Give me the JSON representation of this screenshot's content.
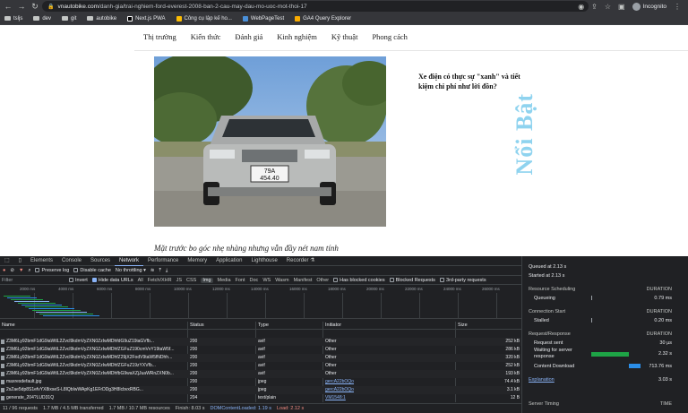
{
  "browser": {
    "url_host": "vnautobike.com",
    "url_path": "/danh-gia/trai-nghiem-ford-everest-2008-ban-2-cau-may-dau-mo-uoc-mot-thoi-17",
    "profile_label": "Incognito",
    "bookmarks": [
      "tsljs",
      "dev",
      "git",
      "autobike",
      "Next.js PWA",
      "Công cụ lập kế ho...",
      "WebPageTest",
      "GA4 Query Explorer"
    ]
  },
  "site": {
    "nav": [
      "Thị trường",
      "Kiến thức",
      "Đánh giá",
      "Kinh nghiệm",
      "Kỹ thuật",
      "Phong cách"
    ],
    "sidebar_headline": "Xe điện có thực sự \"xanh\" và tiết kiệm chi phí như lời đồn?",
    "vertical_label": "Nổi Bật",
    "photo_plate": "79A\n454.40",
    "caption": "Mặt trước bo góc nhẹ nhàng nhưng vẫn đầy nét nam tính"
  },
  "devtools": {
    "tabs": [
      "Elements",
      "Console",
      "Sources",
      "Network",
      "Performance",
      "Memory",
      "Application",
      "Lighthouse",
      "Recorder ⚗"
    ],
    "active_tab": "Network",
    "toolbar": {
      "preserve_log": "Preserve log",
      "disable_cache": "Disable cache",
      "throttling": "No throttling"
    },
    "filter": {
      "placeholder": "Filter",
      "invert": "Invert",
      "hide_data_urls": "Hide data URLs",
      "types": [
        "All",
        "Fetch/XHR",
        "JS",
        "CSS",
        "Img",
        "Media",
        "Font",
        "Doc",
        "WS",
        "Wasm",
        "Manifest",
        "Other"
      ],
      "selected_type": "Img",
      "has_blocked_cookies": "Has blocked cookies",
      "blocked_requests": "Blocked Requests",
      "third_party": "3rd-party requests"
    },
    "timeline_ticks": [
      "2000 ms",
      "4000 ms",
      "6000 ms",
      "8000 ms",
      "10000 ms",
      "12000 ms",
      "14000 ms",
      "16000 ms",
      "18000 ms",
      "20000 ms",
      "22000 ms",
      "24000 ms",
      "26000 ms"
    ],
    "columns": [
      "Name",
      "Status",
      "Type",
      "Initiator",
      "Size"
    ],
    "rows": [
      {
        "name": "Z3M6Ly92bmF1dG9iaWtlL2Zvcl9kdmVyZXN0ZzIwMDhfdG9uZ19iaGVfb...",
        "status": "200",
        "type": "avif",
        "initiator": "Other",
        "size": "252 kB"
      },
      {
        "name": "Z3M6Ly92bmF1dG9iaWtlL2Zvcl9kdmVyZXN0ZzIwMDhfZGFuZ190cmVvY19taW5f...",
        "status": "200",
        "type": "avif",
        "initiator": "Other",
        "size": "286 kB"
      },
      {
        "name": "Z3M6Ly92bmF1dG9iaWtlL2Zvcl9kdmVyZXN0ZzIwMDhfZ29jX2FodV9taW5fNDhh...",
        "status": "200",
        "type": "avif",
        "initiator": "Other",
        "size": "320 kB"
      },
      {
        "name": "Z3M6Ly92bmF1dG9iaWtlL2Zvcl9kdmVyZXN0ZzIwMDhfZGFuZ19zYXVfb...",
        "status": "200",
        "type": "avif",
        "initiator": "Other",
        "size": "252 kB"
      },
      {
        "name": "Z3M6Ly92bmF1dG9iaWtlL2Zvcl9kdmVyZXN0ZzIwMDhfbG9waXZjJuaWRnZXN0b...",
        "status": "200",
        "type": "avif",
        "initiator": "Other",
        "size": "193 kB"
      },
      {
        "name": "maxresdefault.jpg",
        "status": "200",
        "type": "jpeg",
        "initiator": "gercA22bOQo",
        "size": "74.4 kB"
      },
      {
        "name": "2sZae5dp8S1efvYX8ixseS-L8lQbIwWApKg1EFrDDg3H8IcbvxRBG...",
        "status": "200",
        "type": "jpeg",
        "initiator": "gercA22bOQo",
        "size": "3.1 kB"
      },
      {
        "name": "generate_204?LUD31Q",
        "status": "204",
        "type": "text/plain",
        "initiator": "VM1548:1",
        "size": "12 B"
      }
    ],
    "status_bar": {
      "requests": "11 / 96 requests",
      "transferred": "1.7 MB / 4.5 MB transferred",
      "resources": "1.7 MB / 10.7 MB resources",
      "finish": "Finish: 8.03 s",
      "dcl": "DOMContentLoaded: 1.19 s",
      "load": "Load: 2.12 s"
    },
    "timing": {
      "queued_at": "Queued at 2.13 s",
      "started_at": "Started at 2.13 s",
      "resource_scheduling": "Resource Scheduling",
      "duration": "DURATION",
      "queueing": "Queueing",
      "queueing_val": "0.79 ms",
      "connection_start": "Connection Start",
      "stalled": "Stalled",
      "stalled_val": "0.20 ms",
      "request_response": "Request/Response",
      "request_sent": "Request sent",
      "request_sent_val": "30 µs",
      "waiting": "Waiting for server response",
      "waiting_val": "2.32 s",
      "content_download": "Content Download",
      "content_download_val": "713.76 ms",
      "explanation": "Explanation",
      "total_val": "3.03 s",
      "server_timing": "Server Timing",
      "time": "TIME",
      "colors": {
        "waiting": "#1ea446",
        "download": "#2b8ee8"
      }
    }
  }
}
